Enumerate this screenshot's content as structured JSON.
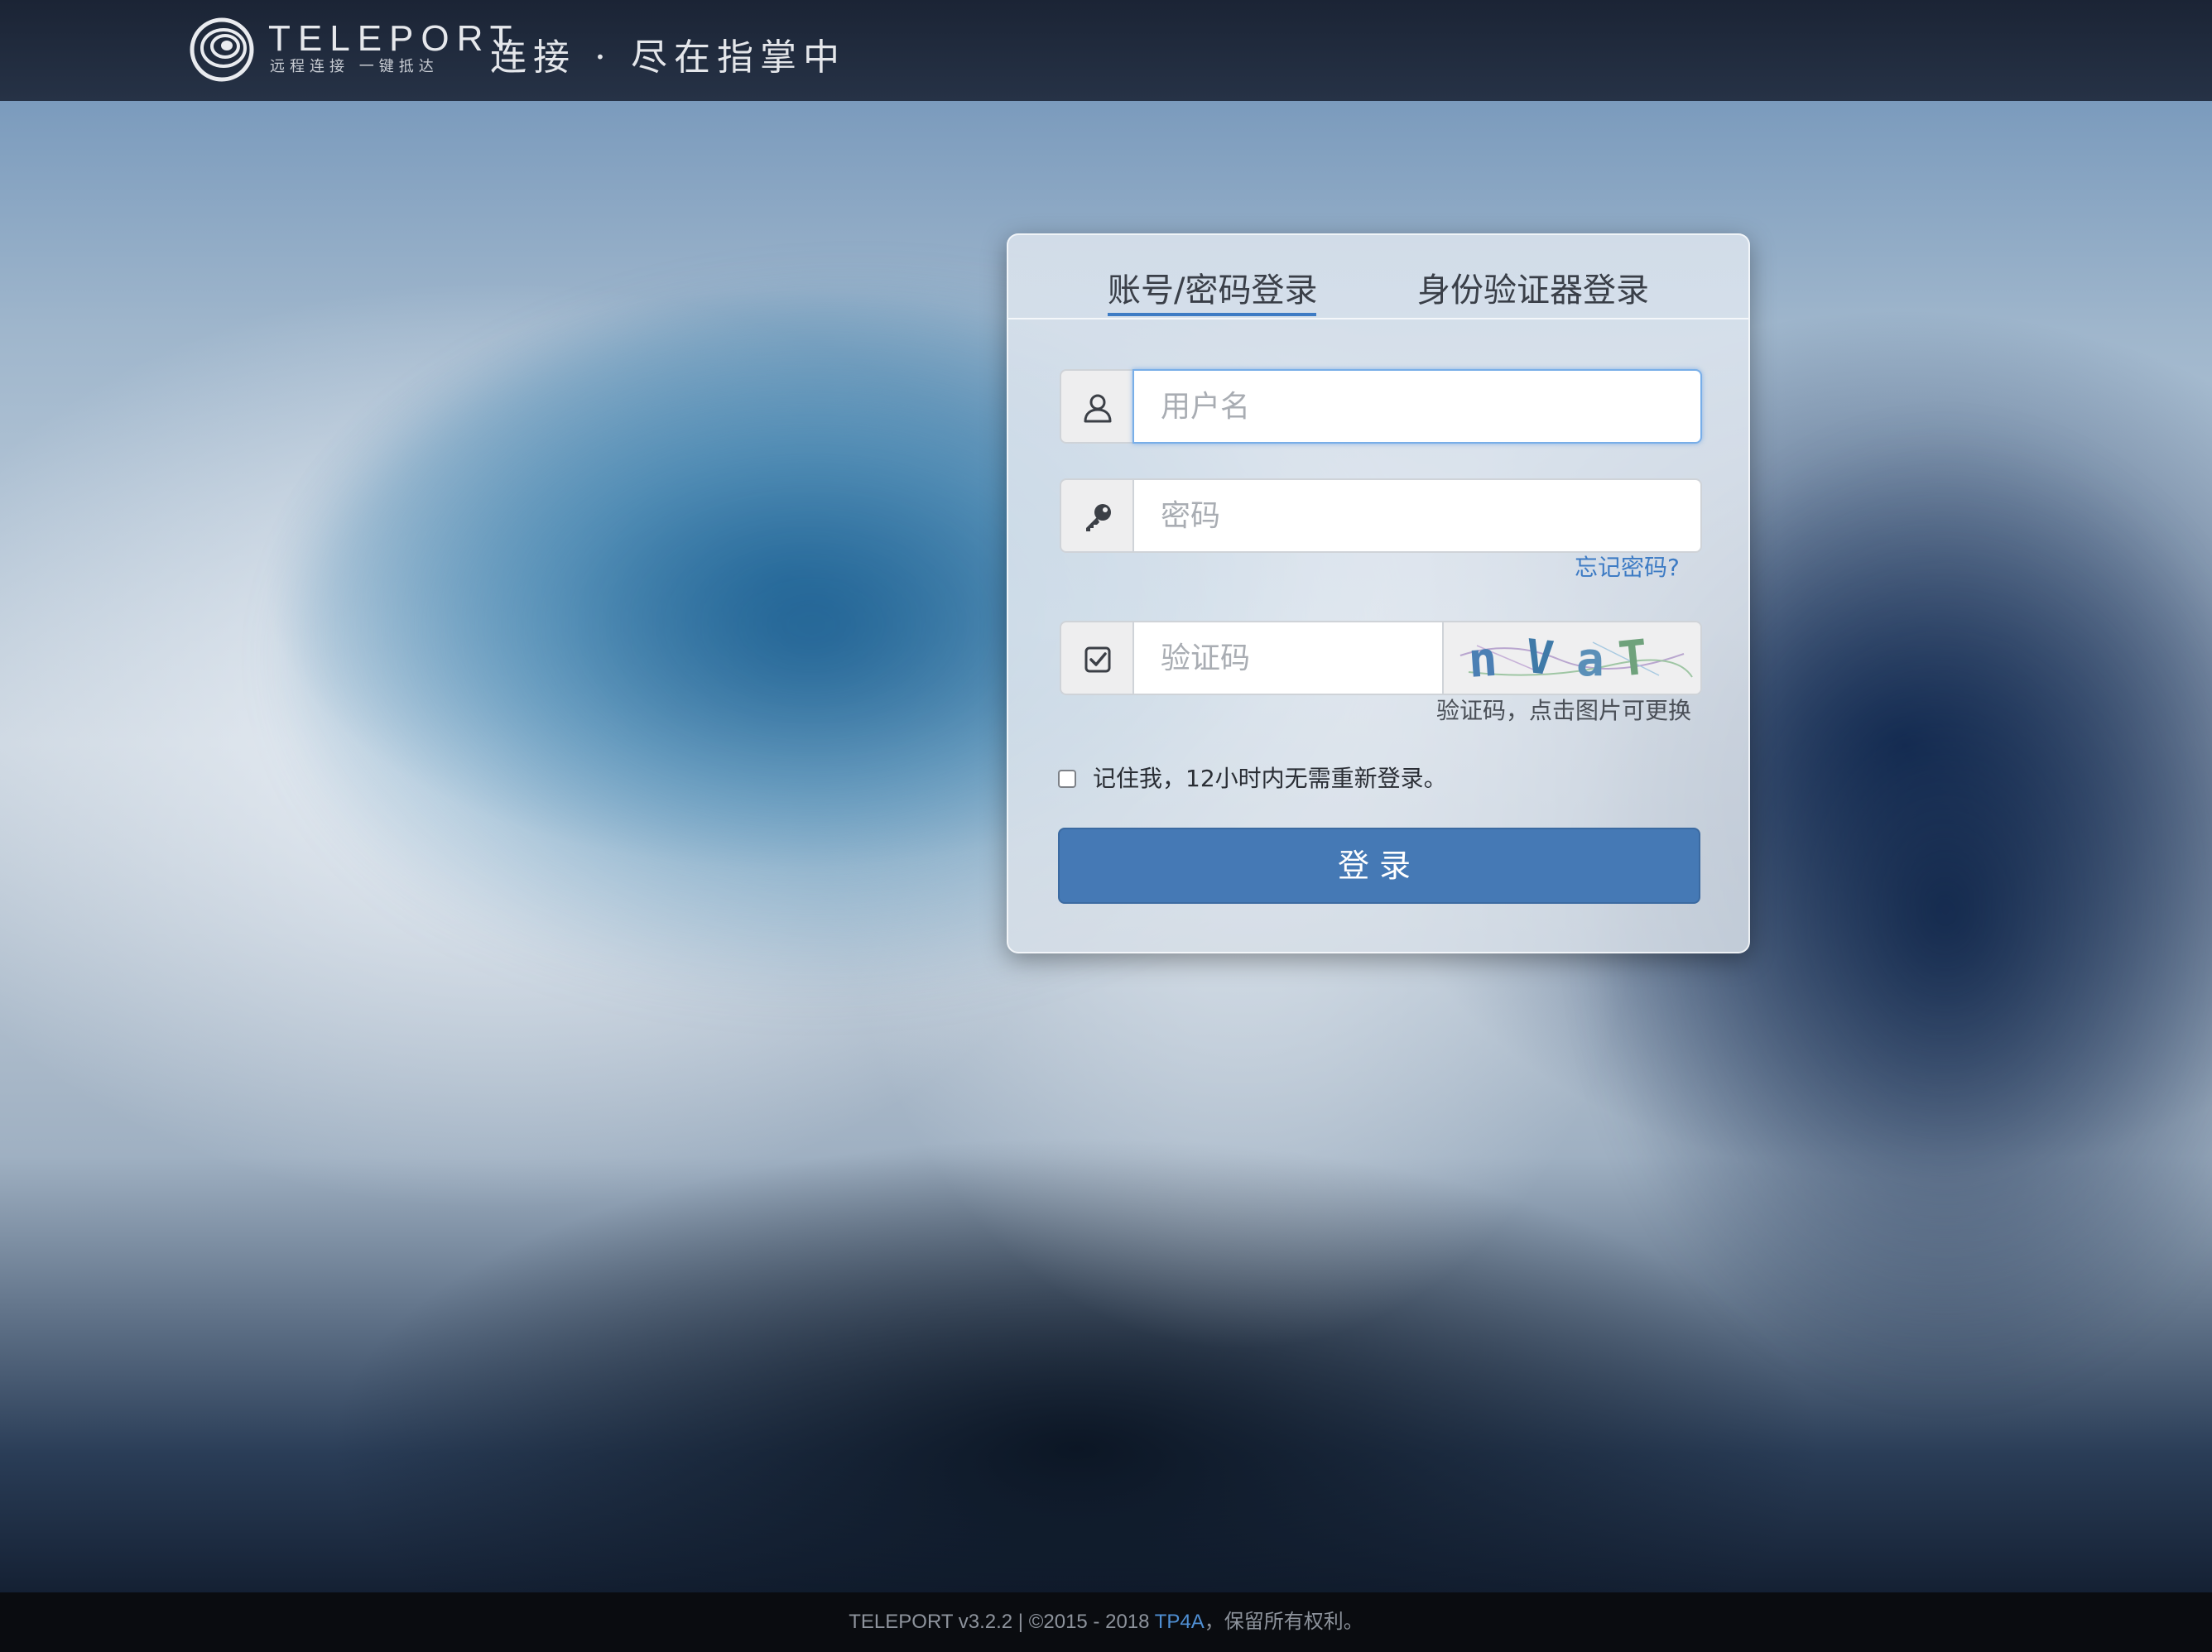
{
  "header": {
    "brand": "TELEPORT",
    "brand_sub": "远程连接 一键抵达",
    "slogan": "连接 · 尽在指掌中"
  },
  "login": {
    "tabs": [
      {
        "label": "账号/密码登录",
        "active": true
      },
      {
        "label": "身份验证器登录",
        "active": false
      }
    ],
    "username": {
      "placeholder": "用户名",
      "value": ""
    },
    "password": {
      "placeholder": "密码",
      "value": ""
    },
    "forgot_link": "忘记密码?",
    "captcha": {
      "placeholder": "验证码",
      "value": "",
      "image_text": "nvaT",
      "hint": "验证码，点击图片可更换"
    },
    "remember_label": "记住我，12小时内无需重新登录。",
    "submit_label": "登录"
  },
  "footer": {
    "prefix": "TELEPORT v3.2.2 | ©2015 - 2018 ",
    "link": "TP4A",
    "suffix": "，保留所有权利。"
  },
  "colors": {
    "accent": "#4579b5",
    "link": "#3d7bc4",
    "header_bg": "#1f2a3c",
    "footer_bg": "#0a0c10"
  },
  "icons": {
    "user": "user-outline-icon",
    "password": "key-icon",
    "captcha": "check-square-icon"
  }
}
